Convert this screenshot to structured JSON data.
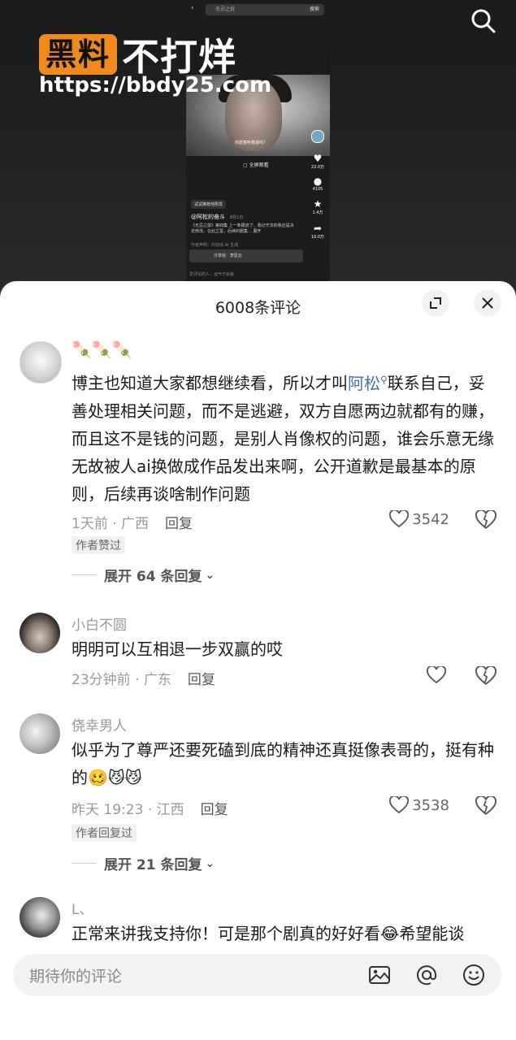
{
  "video": {
    "search_text": "无忌之拢",
    "search_go": "搜索",
    "subtitle": "你愿意听我说吗？",
    "full_screen": "全屏观看",
    "side": [
      {
        "icon": "heart-icon",
        "label": "22.0万"
      },
      {
        "icon": "comment-icon",
        "label": "4105"
      },
      {
        "icon": "star-icon",
        "label": "1.4万"
      },
      {
        "icon": "share-icon",
        "label": "10.0万"
      }
    ],
    "recommend_tag": "试试推荐他刚发",
    "author": "@阿松的奋斗",
    "date": "8月1日",
    "description": "《无忌之拢》第四集 上一条跟流了，我记守法的我还是决定修改，在此立誓，后续的剧集... 展开",
    "ai_note": "作者声明：内容由 AI 生成",
    "share_label": "分享给",
    "share_target": "李星云",
    "input_hint": "爱评论的人，运气不会差"
  },
  "watermark": {
    "badge": "黑料",
    "text": "不打烊",
    "url": "https://bbdy25.com"
  },
  "sheet": {
    "title": "6008条评论"
  },
  "comments": [
    {
      "name": "🍡🍡🍡",
      "text_before": "博主也知道大家都想继续看，所以才叫",
      "mention": "阿松",
      "text_after": "联系自己，妥善处理相关问题，而不是逃避，双方自愿两边就都有的赚，而且这不是钱的问题，是别人肖像权的问题，谁会乐意无缘无故被人ai换做成作品发出来啊，公开道歉是最基本的原则，后续再谈啥制作问题",
      "meta": "1天前 · 广西",
      "reply": "回复",
      "likes": "3542",
      "badge": "作者赞过",
      "expand": "展开 64 条回复"
    },
    {
      "name": "小白不圆",
      "text": "明明可以互相退一步双赢的哎",
      "meta": "23分钟前 · 广东",
      "reply": "回复",
      "likes": ""
    },
    {
      "name": "侥幸男人",
      "text": "似乎为了尊严还要死磕到底的精神还真挺像表哥的，挺有种的🥴😼😼",
      "meta": "昨天 19:23 · 江西",
      "reply": "回复",
      "likes": "3538",
      "badge": "作者回复过",
      "expand": "展开 21 条回复"
    },
    {
      "name": "L、",
      "text": "正常来讲我支持你！可是那个剧真的好好看😂希望能谈"
    }
  ],
  "input": {
    "placeholder": "期待你的评论"
  }
}
